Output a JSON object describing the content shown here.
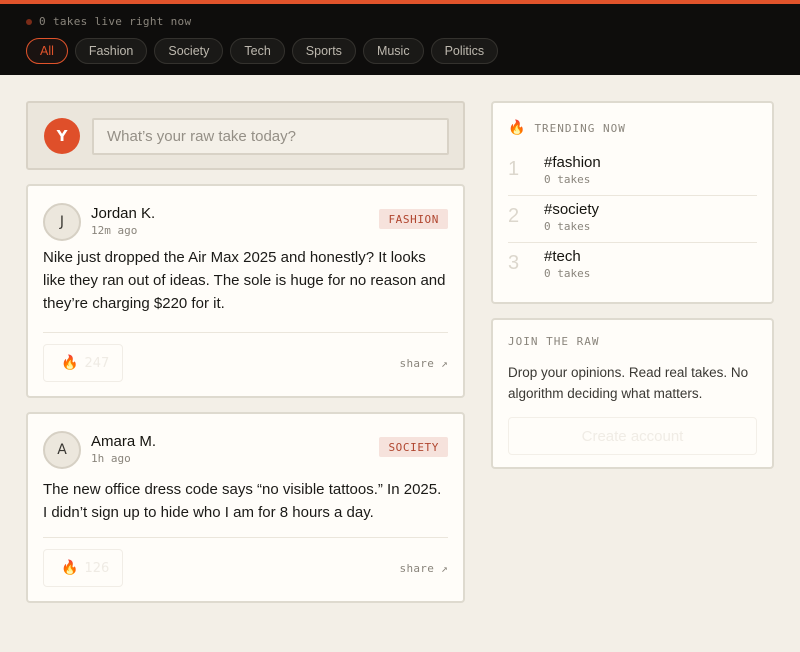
{
  "header": {
    "live_count": "0",
    "live_text": "takes live right now",
    "filters": [
      "All",
      "Fashion",
      "Society",
      "Tech",
      "Sports",
      "Music",
      "Politics"
    ],
    "active_filter": "All"
  },
  "composer": {
    "avatar_initial": "Y",
    "placeholder": "What’s your raw take today?"
  },
  "posts": [
    {
      "initial": "J",
      "author": "Jordan K.",
      "time": "12m ago",
      "tag": "FASHION",
      "body": "Nike just dropped the Air Max 2025 and honestly? It looks like they ran out of ideas. The sole is huge for no reason and they’re charging $220 for it.",
      "reactions": "247",
      "share_label": "share ↗"
    },
    {
      "initial": "A",
      "author": "Amara M.",
      "time": "1h ago",
      "tag": "SOCIETY",
      "body": "The new office dress code says “no visible tattoos.” In 2025. I didn’t sign up to hide who I am for 8 hours a day.",
      "reactions": "126",
      "share_label": "share ↗"
    }
  ],
  "trending": {
    "title": "TRENDING NOW",
    "items": [
      {
        "rank": "1",
        "tag": "#fashion",
        "count": "0 takes"
      },
      {
        "rank": "2",
        "tag": "#society",
        "count": "0 takes"
      },
      {
        "rank": "3",
        "tag": "#tech",
        "count": "0 takes"
      }
    ]
  },
  "join": {
    "title": "JOIN THE RAW",
    "text": "Drop your opinions. Read real takes. No algorithm deciding what matters.",
    "button_label": "Create account"
  },
  "colors": {
    "accent": "#e0532b",
    "background": "#f3efe7",
    "topbar": "#0e0d0c",
    "tag_bg": "#f6e2dc",
    "tag_text": "#b0452e"
  }
}
